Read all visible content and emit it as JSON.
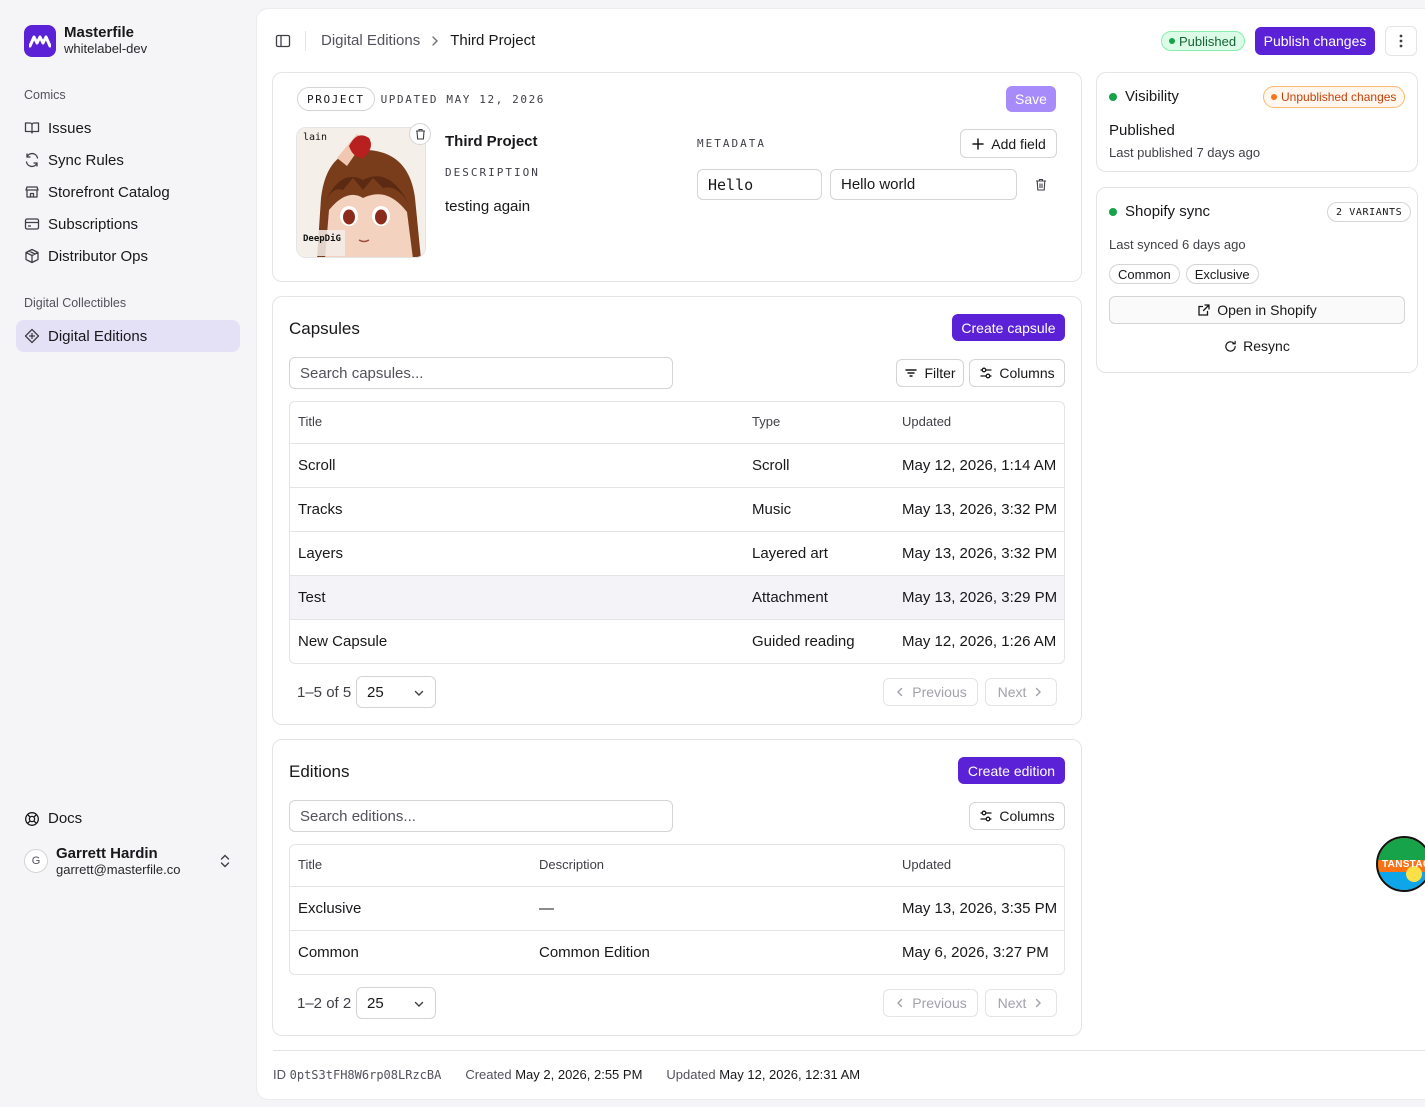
{
  "brand": {
    "name": "Masterfile",
    "org": "whitelabel-dev"
  },
  "sidebar": {
    "groups": [
      {
        "label": "Comics",
        "items": [
          {
            "label": "Issues",
            "icon": "book-open-icon"
          },
          {
            "label": "Sync Rules",
            "icon": "refresh-icon"
          },
          {
            "label": "Storefront Catalog",
            "icon": "store-icon"
          },
          {
            "label": "Subscriptions",
            "icon": "card-icon"
          },
          {
            "label": "Distributor Ops",
            "icon": "package-icon"
          }
        ]
      },
      {
        "label": "Digital Collectibles",
        "items": [
          {
            "label": "Digital Editions",
            "icon": "diamond-icon",
            "active": true
          }
        ]
      }
    ],
    "docs": "Docs",
    "user": {
      "initial": "G",
      "name": "Garrett Hardin",
      "email": "garrett@masterfile.co"
    }
  },
  "topbar": {
    "breadcrumb": [
      "Digital Editions",
      "Third Project"
    ],
    "status": "Published",
    "publish_label": "Publish changes"
  },
  "project": {
    "kind_chip": "PROJECT",
    "updated_chip": "UPDATED MAY 12, 2026",
    "save_label": "Save",
    "title": "Third Project",
    "description_label": "DESCRIPTION",
    "description": "testing again",
    "metadata_label": "METADATA",
    "add_field_label": "Add field",
    "metadata": [
      {
        "key": "Hello",
        "value": "Hello world"
      }
    ],
    "cover": {
      "top_text": "lain",
      "bottom_text": "DeepDiG"
    }
  },
  "capsules": {
    "title": "Capsules",
    "create_label": "Create capsule",
    "search_placeholder": "Search capsules...",
    "filter_label": "Filter",
    "columns_label": "Columns",
    "headers": [
      "Title",
      "Type",
      "Updated"
    ],
    "rows": [
      {
        "title": "Scroll",
        "type": "Scroll",
        "updated": "May 12, 2026, 1:14 AM"
      },
      {
        "title": "Tracks",
        "type": "Music",
        "updated": "May 13, 2026, 3:32 PM"
      },
      {
        "title": "Layers",
        "type": "Layered art",
        "updated": "May 13, 2026, 3:32 PM"
      },
      {
        "title": "Test",
        "type": "Attachment",
        "updated": "May 13, 2026, 3:29 PM"
      },
      {
        "title": "New Capsule",
        "type": "Guided reading",
        "updated": "May 12, 2026, 1:26 AM"
      }
    ],
    "pager": {
      "count": "1–5 of 5",
      "page_size": "25",
      "prev": "Previous",
      "next": "Next"
    }
  },
  "editions": {
    "title": "Editions",
    "create_label": "Create edition",
    "search_placeholder": "Search editions...",
    "columns_label": "Columns",
    "headers": [
      "Title",
      "Description",
      "Updated"
    ],
    "rows": [
      {
        "title": "Exclusive",
        "description": "—",
        "updated": "May 13, 2026, 3:35 PM"
      },
      {
        "title": "Common",
        "description": "Common Edition",
        "updated": "May 6, 2026, 3:27 PM"
      }
    ],
    "pager": {
      "count": "1–2 of 2",
      "page_size": "25",
      "prev": "Previous",
      "next": "Next"
    }
  },
  "visibility": {
    "title": "Visibility",
    "badge": "Unpublished changes",
    "state": "Published",
    "last": "Last published 7 days ago"
  },
  "shopify": {
    "title": "Shopify sync",
    "variants_chip": "2 VARIANTS",
    "last": "Last synced 6 days ago",
    "variants": [
      "Common",
      "Exclusive"
    ],
    "open_label": "Open in Shopify",
    "resync_label": "Resync"
  },
  "footer": {
    "id_label": "ID",
    "id_value": "0ptS3tFH8W6rp08LRzcBA",
    "created_label": "Created",
    "created_value": "May 2, 2026, 2:55 PM",
    "updated_label": "Updated",
    "updated_value": "May 12, 2026, 12:31 AM"
  },
  "devtools": {
    "label": "TANSTACK"
  },
  "colors": {
    "accent": "#5b21d6",
    "success": "#16a34a",
    "warning": "#f97316"
  }
}
